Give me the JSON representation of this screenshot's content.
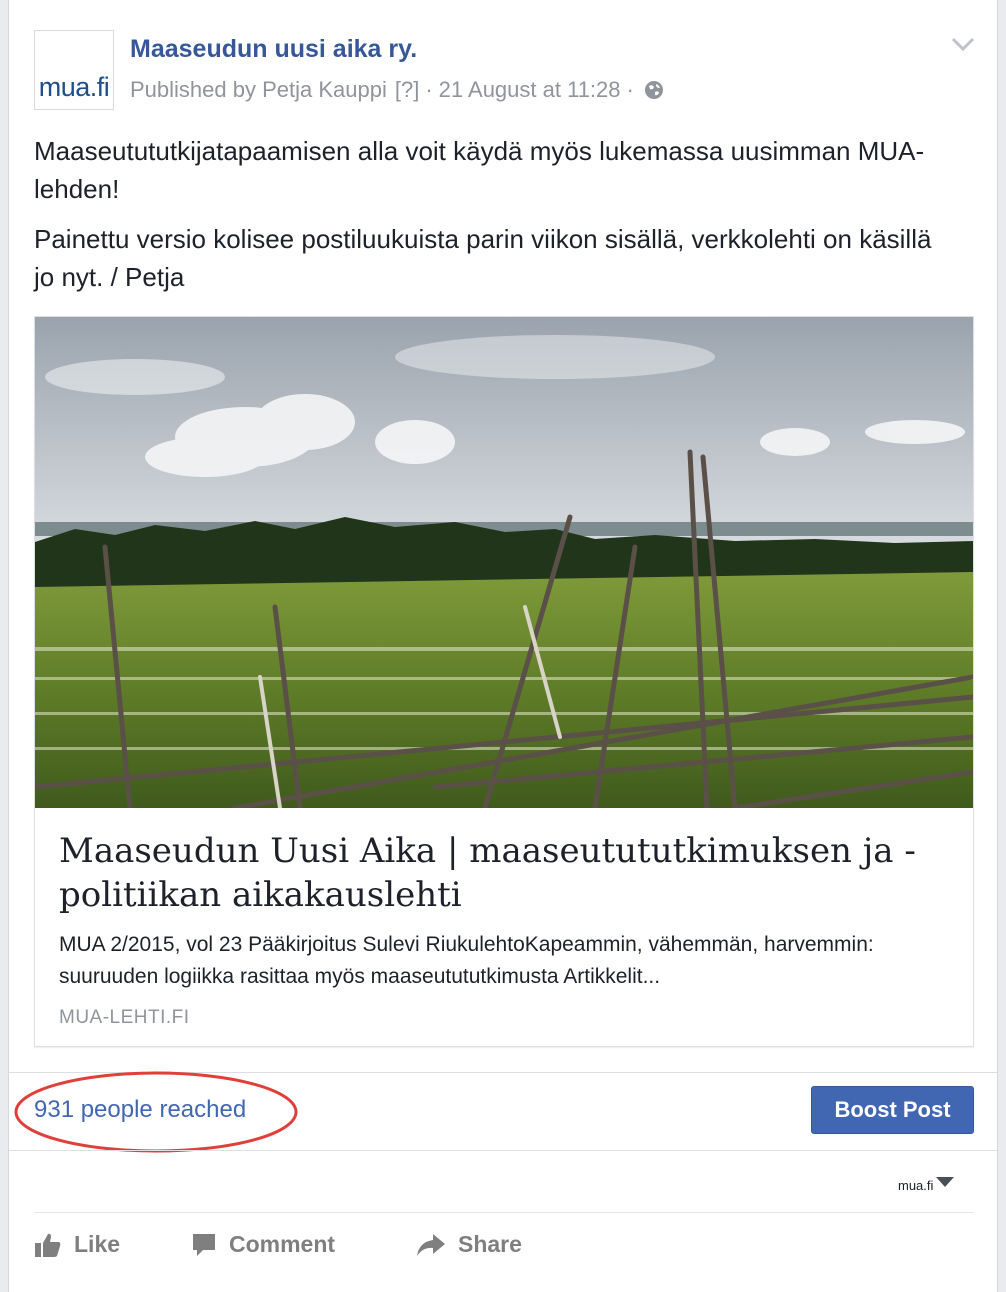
{
  "header": {
    "page_name": "Maaseudun uusi aika ry.",
    "avatar_text": "mua.fi",
    "published_by": "Published by Petja Kauppi",
    "help_marker": "[?]",
    "separator": "·",
    "timestamp": "21 August at 11:28",
    "privacy_icon": "globe-icon",
    "menu_icon": "chevron-down-icon"
  },
  "post": {
    "paragraphs": [
      "Maaseutututkijatapaamisen alla voit käydä myös lukemassa uusimman MUA-lehden!",
      "Painettu versio kolisee postiluukuista parin viikon sisällä, verkkolehti on käsillä jo nyt. / Petja"
    ]
  },
  "link_preview": {
    "title": "Maaseudun Uusi Aika | maaseutututkimuksen ja -politiikan aikakauslehti",
    "description": "MUA 2/2015, vol 23 Pääkirjoitus Sulevi RiukulehtoKapeammin, vähemmän, harvemmin: suuruuden logiikka rasittaa myös maaseutututkimusta Artikkelit...",
    "domain": "MUA-LEHTI.FI"
  },
  "insights": {
    "reach_text": "931 people reached",
    "boost_label": "Boost Post",
    "annotation_color": "#e0403a"
  },
  "acting_as": {
    "label": "mua.fi"
  },
  "actions": {
    "like": "Like",
    "comment": "Comment",
    "share": "Share"
  },
  "colors": {
    "link_blue": "#365899",
    "button_blue": "#4267b2",
    "meta_gray": "#90949c"
  }
}
